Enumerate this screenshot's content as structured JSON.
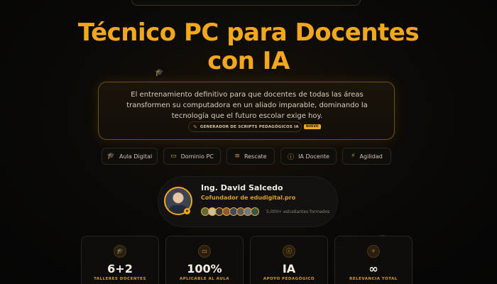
{
  "hero": {
    "title_line1": "Técnico PC para Docentes",
    "title_line2": "con IA"
  },
  "description": {
    "text": "El entrenamiento definitivo para que docentes de todas las áreas transformen su computadora en un aliado imparable, dominando la tecnología que el futuro escolar exige hoy.",
    "promo_label": "GENERADOR DE SCRIPTS PEDAGÓGICOS IA",
    "promo_badge": "NUEVO"
  },
  "nav": {
    "items": [
      {
        "label": "Aula Digital",
        "icon": "graduation-cap-icon"
      },
      {
        "label": "Dominio PC",
        "icon": "laptop-icon"
      },
      {
        "label": "Rescate",
        "icon": "database-icon"
      },
      {
        "label": "IA Docente",
        "icon": "info-icon"
      },
      {
        "label": "Agilidad",
        "icon": "lightning-icon"
      }
    ]
  },
  "profile": {
    "name": "Ing. David Salcedo",
    "role": "Cofundador de edudigital.pro",
    "students_text": "5,000+ estudiantes formados"
  },
  "stats": [
    {
      "value": "6+2",
      "label": "TALLERES DOCENTES",
      "icon": "graduation-cap-icon"
    },
    {
      "value": "100%",
      "label": "APLICABLE AL AULA",
      "icon": "laptop-icon"
    },
    {
      "value": "IA",
      "label": "APOYO PEDAGÓGICO",
      "icon": "info-icon"
    },
    {
      "value": "∞",
      "label": "RELEVANCIA TOTAL",
      "icon": "sparkle-icon"
    }
  ],
  "colors": {
    "accent": "#f3a71a",
    "background": "#050505"
  }
}
